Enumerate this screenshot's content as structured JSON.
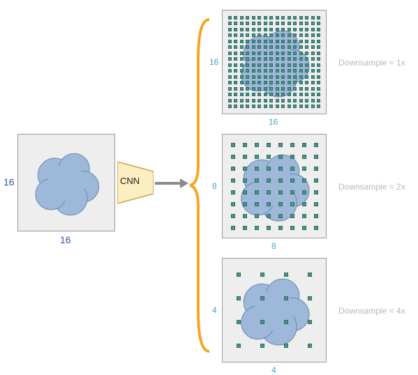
{
  "input": {
    "width_label": "16",
    "height_label": "16"
  },
  "cnn": {
    "label": "CNN"
  },
  "outputs": [
    {
      "width_label": "16",
      "height_label": "16",
      "caption": "Downsample = 1x",
      "grid": 16
    },
    {
      "width_label": "8",
      "height_label": "8",
      "caption": "Downsample = 2x",
      "grid": 8
    },
    {
      "width_label": "4",
      "height_label": "4",
      "caption": "Downsample = 4x",
      "grid": 4
    }
  ],
  "colors": {
    "cloud": "#9eb8d9",
    "box_bg": "#eeeeee",
    "box_border": "#888888",
    "dot": "#4a9488",
    "dim_label": "#2b55a8",
    "cnn_fill": "#fbeec1",
    "cnn_stroke": "#c7a14a",
    "arrow": "#8a8a8a",
    "brace": "#f5a623",
    "muted": "#b8b8b8"
  },
  "chart_data": {
    "type": "diagram",
    "description": "A 16×16 input image is passed through a CNN producing three feature maps at different downsample rates.",
    "input": {
      "width": 16,
      "height": 16
    },
    "operator": "CNN",
    "outputs": [
      {
        "downsample": 1,
        "width": 16,
        "height": 16,
        "label": "Downsample = 1x"
      },
      {
        "downsample": 2,
        "width": 8,
        "height": 8,
        "label": "Downsample = 2x"
      },
      {
        "downsample": 4,
        "width": 4,
        "height": 4,
        "label": "Downsample = 4x"
      }
    ]
  }
}
